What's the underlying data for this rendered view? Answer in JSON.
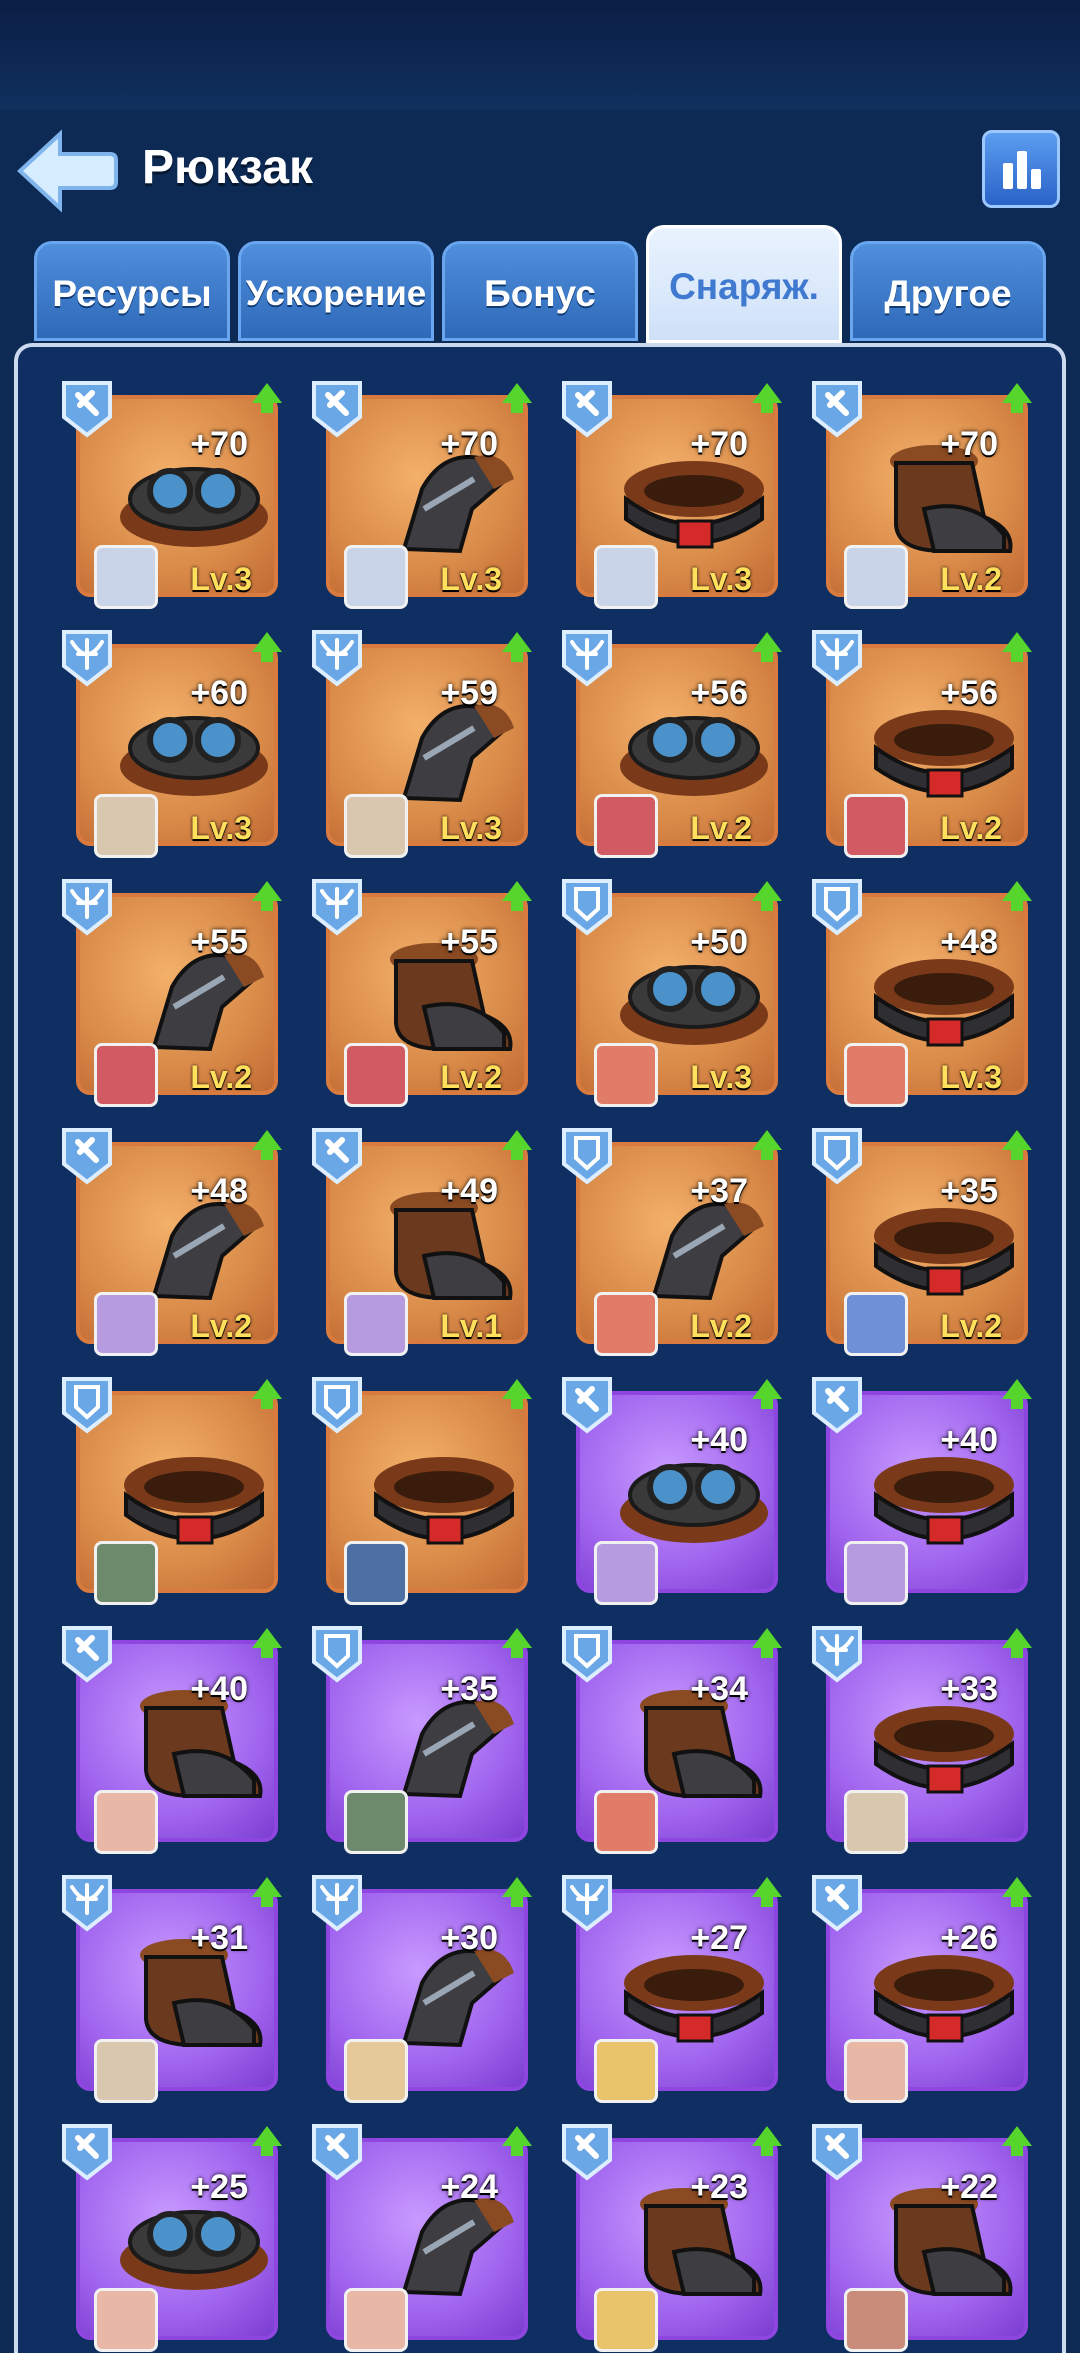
{
  "header": {
    "title": "Рюкзак"
  },
  "tabs": [
    "Ресурсы",
    "Ускорение",
    "Бонус",
    "Снаряж.",
    "Другое"
  ],
  "active_tab": 3,
  "colors": {
    "common_card": "#d98a48",
    "epic_card": "#a064ee",
    "level_text": "#ffe05c",
    "up_arrow": "#56d62c"
  },
  "items": [
    {
      "type": "tool",
      "gear": "goggles",
      "bonus": "+70",
      "level": "Lv.3",
      "rarity": "rare",
      "avatar": "#c9d4e8"
    },
    {
      "type": "tool",
      "gear": "gauntlet",
      "bonus": "+70",
      "level": "Lv.3",
      "rarity": "rare",
      "avatar": "#c9d4e8"
    },
    {
      "type": "tool",
      "gear": "belt",
      "bonus": "+70",
      "level": "Lv.3",
      "rarity": "rare",
      "avatar": "#c9d4e8"
    },
    {
      "type": "tool",
      "gear": "boot",
      "bonus": "+70",
      "level": "Lv.2",
      "rarity": "rare",
      "avatar": "#c9d4e8"
    },
    {
      "type": "crossbow",
      "gear": "goggles",
      "bonus": "+60",
      "level": "Lv.3",
      "rarity": "rare",
      "avatar": "#d9c7b0"
    },
    {
      "type": "crossbow",
      "gear": "gauntlet",
      "bonus": "+59",
      "level": "Lv.3",
      "rarity": "rare",
      "avatar": "#d9c7b0"
    },
    {
      "type": "crossbow",
      "gear": "goggles",
      "bonus": "+56",
      "level": "Lv.2",
      "rarity": "rare",
      "avatar": "#d25a63"
    },
    {
      "type": "crossbow",
      "gear": "belt",
      "bonus": "+56",
      "level": "Lv.2",
      "rarity": "rare",
      "avatar": "#d25a63"
    },
    {
      "type": "crossbow",
      "gear": "gauntlet",
      "bonus": "+55",
      "level": "Lv.2",
      "rarity": "rare",
      "avatar": "#d25a63"
    },
    {
      "type": "crossbow",
      "gear": "boot",
      "bonus": "+55",
      "level": "Lv.2",
      "rarity": "rare",
      "avatar": "#d25a63"
    },
    {
      "type": "shield",
      "gear": "goggles",
      "bonus": "+50",
      "level": "Lv.3",
      "rarity": "rare",
      "avatar": "#e07c67"
    },
    {
      "type": "shield",
      "gear": "belt",
      "bonus": "+48",
      "level": "Lv.3",
      "rarity": "rare",
      "avatar": "#e07c67"
    },
    {
      "type": "tool",
      "gear": "gauntlet",
      "bonus": "+48",
      "level": "Lv.2",
      "rarity": "rare",
      "avatar": "#b69be0"
    },
    {
      "type": "tool",
      "gear": "boot",
      "bonus": "+49",
      "level": "Lv.1",
      "rarity": "rare",
      "avatar": "#b69be0"
    },
    {
      "type": "shield",
      "gear": "gauntlet",
      "bonus": "+37",
      "level": "Lv.2",
      "rarity": "rare",
      "avatar": "#e07c67"
    },
    {
      "type": "shield",
      "gear": "belt",
      "bonus": "+35",
      "level": "Lv.2",
      "rarity": "rare",
      "avatar": "#6f8fd6"
    },
    {
      "type": "shield",
      "gear": "belt",
      "bonus": "",
      "level": "",
      "rarity": "rare",
      "avatar": "#6d8a6c"
    },
    {
      "type": "shield",
      "gear": "belt",
      "bonus": "",
      "level": "",
      "rarity": "rare",
      "avatar": "#4e6fa3"
    },
    {
      "type": "tool",
      "gear": "goggles",
      "bonus": "+40",
      "level": "",
      "rarity": "epic",
      "avatar": "#b69be0"
    },
    {
      "type": "tool",
      "gear": "belt",
      "bonus": "+40",
      "level": "",
      "rarity": "epic",
      "avatar": "#b69be0"
    },
    {
      "type": "tool",
      "gear": "boot",
      "bonus": "+40",
      "level": "",
      "rarity": "epic",
      "avatar": "#e9b7a6"
    },
    {
      "type": "shield",
      "gear": "gauntlet",
      "bonus": "+35",
      "level": "",
      "rarity": "epic",
      "avatar": "#6d8a6c"
    },
    {
      "type": "shield",
      "gear": "boot",
      "bonus": "+34",
      "level": "",
      "rarity": "epic",
      "avatar": "#e07c67"
    },
    {
      "type": "crossbow",
      "gear": "belt",
      "bonus": "+33",
      "level": "",
      "rarity": "epic",
      "avatar": "#d9c7b0"
    },
    {
      "type": "crossbow",
      "gear": "boot",
      "bonus": "+31",
      "level": "",
      "rarity": "epic",
      "avatar": "#d9c7b0"
    },
    {
      "type": "crossbow",
      "gear": "gauntlet",
      "bonus": "+30",
      "level": "",
      "rarity": "epic",
      "avatar": "#e6c99b"
    },
    {
      "type": "crossbow",
      "gear": "belt",
      "bonus": "+27",
      "level": "",
      "rarity": "epic",
      "avatar": "#e9c46a"
    },
    {
      "type": "tool",
      "gear": "belt",
      "bonus": "+26",
      "level": "",
      "rarity": "epic",
      "avatar": "#e9b7a6"
    },
    {
      "type": "tool",
      "gear": "goggles",
      "bonus": "+25",
      "level": "",
      "rarity": "epic",
      "avatar": "#e9b7a6"
    },
    {
      "type": "tool",
      "gear": "gauntlet",
      "bonus": "+24",
      "level": "",
      "rarity": "epic",
      "avatar": "#e9b7a6"
    },
    {
      "type": "tool",
      "gear": "boot",
      "bonus": "+23",
      "level": "",
      "rarity": "epic",
      "avatar": "#e9c46a"
    },
    {
      "type": "tool",
      "gear": "boot",
      "bonus": "+22",
      "level": "",
      "rarity": "epic",
      "avatar": "#c98b7a"
    }
  ]
}
